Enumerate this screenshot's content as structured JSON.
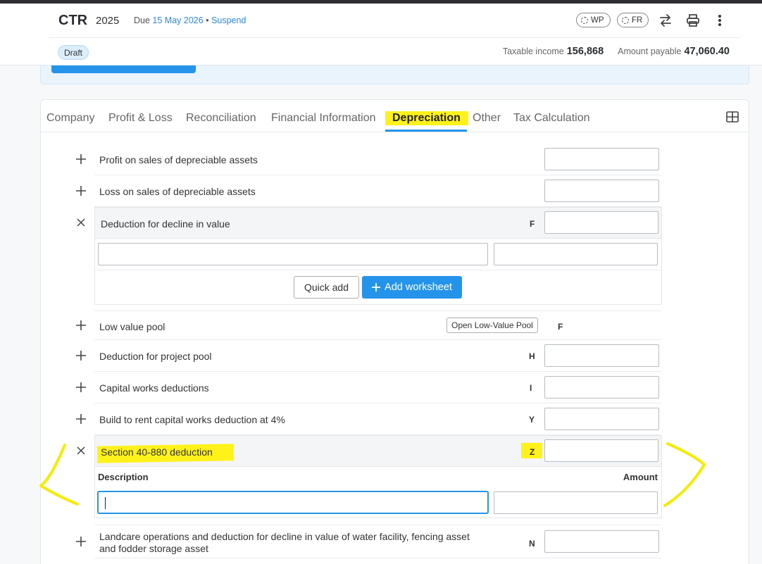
{
  "header": {
    "title": "CTR",
    "year": "2025",
    "due_label": "Due",
    "due_date": "15 May 2026",
    "bullet": "•",
    "suspend_label": "Suspend",
    "pills": [
      "WP",
      "FR"
    ],
    "status_badge": "Draft",
    "taxable_income_label": "Taxable income",
    "taxable_income_value": "156,868",
    "amount_payable_label": "Amount payable",
    "amount_payable_value": "47,060.40"
  },
  "tabs": [
    {
      "label": "Company",
      "active": false
    },
    {
      "label": "Profit & Loss",
      "active": false
    },
    {
      "label": "Reconciliation",
      "active": false
    },
    {
      "label": "Financial Information",
      "active": false
    },
    {
      "label": "Depreciation",
      "active": true
    },
    {
      "label": "Other",
      "active": false
    },
    {
      "label": "Tax Calculation",
      "active": false
    }
  ],
  "rows": {
    "profit_on_sales": {
      "label": "Profit on sales of depreciable assets",
      "code": ""
    },
    "loss_on_sales": {
      "label": "Loss on sales of depreciable assets",
      "code": ""
    },
    "decline_in_value": {
      "label": "Deduction for decline in value",
      "code": "F"
    },
    "low_value_pool": {
      "label": "Low value pool",
      "code": "F",
      "button": "Open Low-Value Pool"
    },
    "project_pool": {
      "label": "Deduction for project pool",
      "code": "H"
    },
    "capital_works": {
      "label": "Capital works deductions",
      "code": "I"
    },
    "build_to_rent": {
      "label": "Build to rent capital works deduction at 4%",
      "code": "Y"
    },
    "section_40_880": {
      "label": "Section 40-880 deduction",
      "code": "Z"
    },
    "landcare_line1": "Landcare operations and deduction for decline in value of water facility, fencing asset",
    "landcare_line2": "and fodder storage asset",
    "landcare_code": "N"
  },
  "buttons": {
    "quick_add": "Quick add",
    "add_worksheet": "Add worksheet"
  },
  "columns": {
    "description": "Description",
    "amount": "Amount"
  },
  "colors": {
    "accent": "#2394ea",
    "highlight": "#fff21a"
  }
}
